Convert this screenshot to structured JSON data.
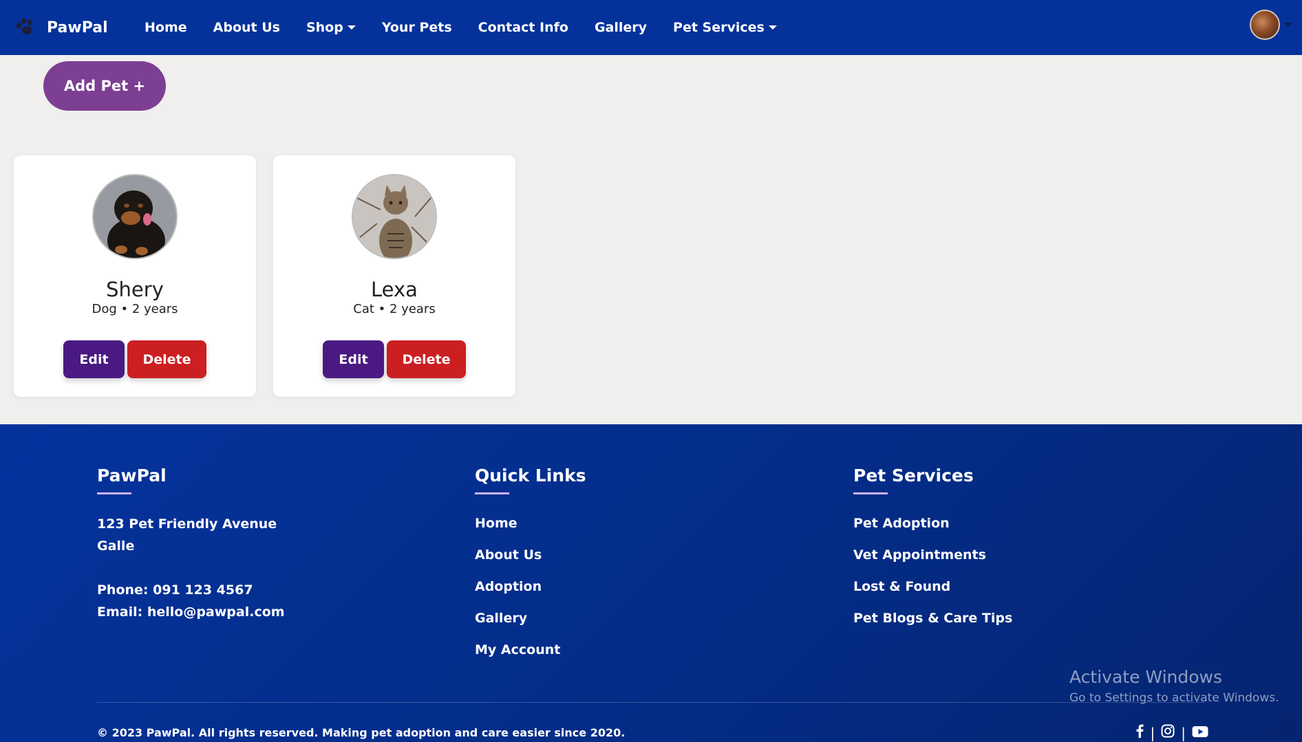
{
  "nav": {
    "brand": "PawPal",
    "items": [
      {
        "label": "Home"
      },
      {
        "label": "About Us"
      },
      {
        "label": "Shop",
        "dropdown": true
      },
      {
        "label": "Your Pets"
      },
      {
        "label": "Contact Info"
      },
      {
        "label": "Gallery"
      },
      {
        "label": "Pet Services",
        "dropdown": true
      }
    ],
    "avatar_icon": "user-avatar"
  },
  "main": {
    "add_pet_label": "Add Pet +",
    "pets": [
      {
        "name": "Shery",
        "meta": "Dog • 2 years",
        "edit_label": "Edit",
        "delete_label": "Delete"
      },
      {
        "name": "Lexa",
        "meta": "Cat • 2 years",
        "edit_label": "Edit",
        "delete_label": "Delete"
      }
    ]
  },
  "footer": {
    "col1": {
      "title": "PawPal",
      "address_line1": "123 Pet Friendly Avenue",
      "address_line2": "Galle",
      "phone": "Phone: 091 123 4567",
      "email": "Email: hello@pawpal.com"
    },
    "col2": {
      "title": "Quick Links",
      "links": [
        "Home",
        "About Us",
        "Adoption",
        "Gallery",
        "My Account"
      ]
    },
    "col3": {
      "title": "Pet Services",
      "links": [
        "Pet Adoption",
        "Vet Appointments",
        "Lost & Found",
        "Pet Blogs & Care Tips"
      ]
    },
    "copyright": "© 2023 PawPal. All rights reserved. Making pet adoption and care easier since 2020.",
    "social": [
      "facebook-icon",
      "instagram-icon",
      "youtube-icon"
    ],
    "separator": "|"
  },
  "overlay": {
    "activate_title": "Activate Windows",
    "activate_sub": "Go to Settings to activate Windows."
  },
  "colors": {
    "nav_bg": "#04329a",
    "add_pet": "#7d3f93",
    "edit": "#4a1a82",
    "delete": "#cb1f22",
    "page_bg": "#f0efee"
  }
}
